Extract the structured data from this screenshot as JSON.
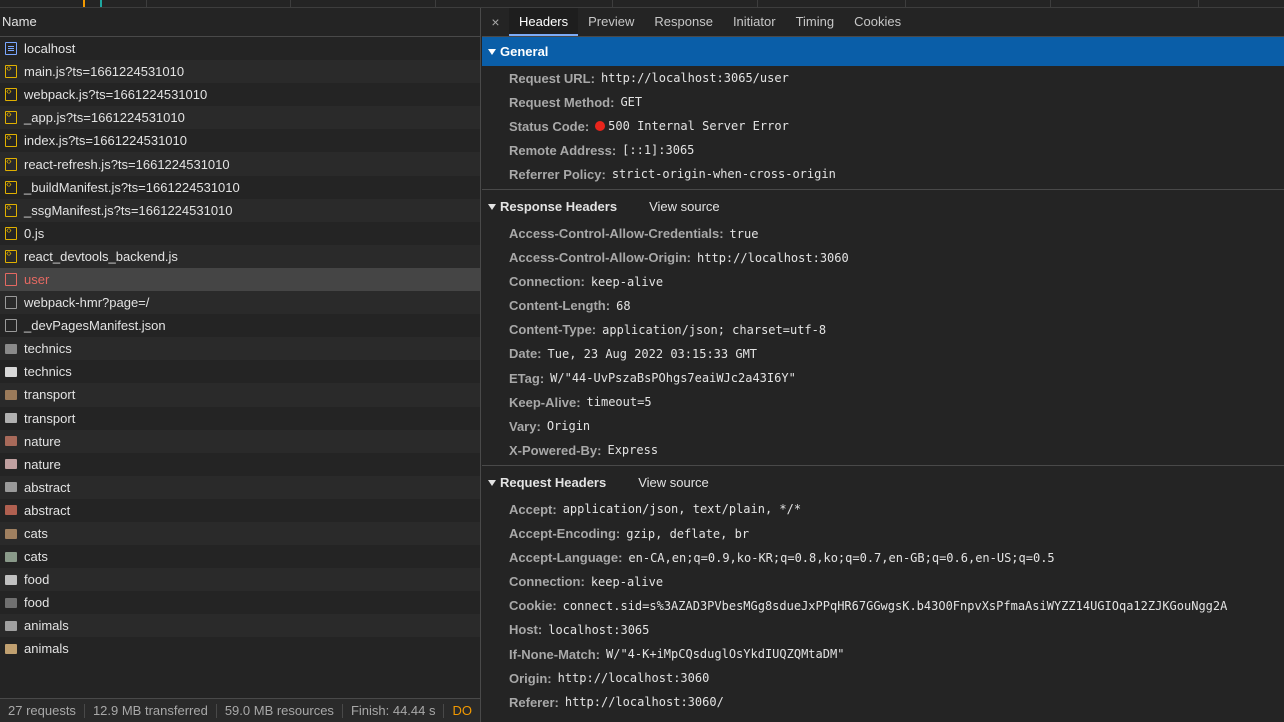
{
  "network": {
    "column_name": "Name",
    "requests": [
      {
        "name": "localhost",
        "icon": "document-icon",
        "type": "doc"
      },
      {
        "name": "main.js?ts=1661224531010",
        "icon": "script-icon",
        "type": "js"
      },
      {
        "name": "webpack.js?ts=1661224531010",
        "icon": "script-icon",
        "type": "js"
      },
      {
        "name": "_app.js?ts=1661224531010",
        "icon": "script-icon",
        "type": "js"
      },
      {
        "name": "index.js?ts=1661224531010",
        "icon": "script-icon",
        "type": "js"
      },
      {
        "name": "react-refresh.js?ts=1661224531010",
        "icon": "script-icon",
        "type": "js"
      },
      {
        "name": "_buildManifest.js?ts=1661224531010",
        "icon": "script-icon",
        "type": "js"
      },
      {
        "name": "_ssgManifest.js?ts=1661224531010",
        "icon": "script-icon",
        "type": "js"
      },
      {
        "name": "0.js",
        "icon": "script-icon",
        "type": "js"
      },
      {
        "name": "react_devtools_backend.js",
        "icon": "script-icon",
        "type": "js"
      },
      {
        "name": "user",
        "icon": "error-request-icon",
        "type": "error"
      },
      {
        "name": "webpack-hmr?page=/",
        "icon": "file-icon",
        "type": "plain"
      },
      {
        "name": "_devPagesManifest.json",
        "icon": "file-icon",
        "type": "plain"
      },
      {
        "name": "technics",
        "icon": "image-thumbnail-icon",
        "type": "img",
        "color": "#8a8a8a"
      },
      {
        "name": "technics",
        "icon": "image-thumbnail-icon",
        "type": "img",
        "color": "#d8d8d8"
      },
      {
        "name": "transport",
        "icon": "image-thumbnail-icon",
        "type": "img",
        "color": "#9a7a5a"
      },
      {
        "name": "transport",
        "icon": "image-thumbnail-icon",
        "type": "img",
        "color": "#b0b0b0"
      },
      {
        "name": "nature",
        "icon": "image-thumbnail-icon",
        "type": "img",
        "color": "#a86a5a"
      },
      {
        "name": "nature",
        "icon": "image-thumbnail-icon",
        "type": "img",
        "color": "#c0a0a0"
      },
      {
        "name": "abstract",
        "icon": "image-thumbnail-icon",
        "type": "img",
        "color": "#9a9a9a"
      },
      {
        "name": "abstract",
        "icon": "image-thumbnail-icon",
        "type": "img",
        "color": "#b06050"
      },
      {
        "name": "cats",
        "icon": "image-thumbnail-icon",
        "type": "img",
        "color": "#a08060"
      },
      {
        "name": "cats",
        "icon": "image-thumbnail-icon",
        "type": "img",
        "color": "#8a9a8a"
      },
      {
        "name": "food",
        "icon": "image-thumbnail-icon",
        "type": "img",
        "color": "#c0c0c0"
      },
      {
        "name": "food",
        "icon": "image-thumbnail-icon",
        "type": "img",
        "color": "#707070"
      },
      {
        "name": "animals",
        "icon": "image-thumbnail-icon",
        "type": "img",
        "color": "#a0a0a0"
      },
      {
        "name": "animals",
        "icon": "image-thumbnail-icon",
        "type": "img",
        "color": "#c0a070"
      }
    ],
    "selected_request": "user",
    "status": {
      "requests": "27 requests",
      "transferred": "12.9 MB transferred",
      "resources": "59.0 MB resources",
      "finish": "Finish: 44.44 s",
      "dom": "DO"
    }
  },
  "detail": {
    "close_glyph": "×",
    "tabs": [
      "Headers",
      "Preview",
      "Response",
      "Initiator",
      "Timing",
      "Cookies"
    ],
    "active_tab": "Headers",
    "general": {
      "title": "General",
      "items": [
        {
          "key": "Request URL:",
          "value": "http://localhost:3065/user"
        },
        {
          "key": "Request Method:",
          "value": "GET"
        },
        {
          "key": "Status Code:",
          "value": "500 Internal Server Error",
          "status_color": "#e8251c"
        },
        {
          "key": "Remote Address:",
          "value": "[::1]:3065"
        },
        {
          "key": "Referrer Policy:",
          "value": "strict-origin-when-cross-origin"
        }
      ]
    },
    "response_headers": {
      "title": "Response Headers",
      "view_source": "View source",
      "items": [
        {
          "key": "Access-Control-Allow-Credentials:",
          "value": "true"
        },
        {
          "key": "Access-Control-Allow-Origin:",
          "value": "http://localhost:3060"
        },
        {
          "key": "Connection:",
          "value": "keep-alive"
        },
        {
          "key": "Content-Length:",
          "value": "68"
        },
        {
          "key": "Content-Type:",
          "value": "application/json; charset=utf-8"
        },
        {
          "key": "Date:",
          "value": "Tue, 23 Aug 2022 03:15:33 GMT"
        },
        {
          "key": "ETag:",
          "value": "W/\"44-UvPszaBsPOhgs7eaiWJc2a43I6Y\""
        },
        {
          "key": "Keep-Alive:",
          "value": "timeout=5"
        },
        {
          "key": "Vary:",
          "value": "Origin"
        },
        {
          "key": "X-Powered-By:",
          "value": "Express"
        }
      ]
    },
    "request_headers": {
      "title": "Request Headers",
      "view_source": "View source",
      "items": [
        {
          "key": "Accept:",
          "value": "application/json, text/plain, */*"
        },
        {
          "key": "Accept-Encoding:",
          "value": "gzip, deflate, br"
        },
        {
          "key": "Accept-Language:",
          "value": "en-CA,en;q=0.9,ko-KR;q=0.8,ko;q=0.7,en-GB;q=0.6,en-US;q=0.5"
        },
        {
          "key": "Connection:",
          "value": "keep-alive"
        },
        {
          "key": "Cookie:",
          "value": "connect.sid=s%3AZAD3PVbesMGg8sdueJxPPqHR67GGwgsK.b43O0FnpvXsPfmaAsiWYZZ14UGIOqa12ZJKGouNgg2A"
        },
        {
          "key": "Host:",
          "value": "localhost:3065"
        },
        {
          "key": "If-None-Match:",
          "value": "W/\"4-K+iMpCQsduglOsYkdIUQZQMtaDM\""
        },
        {
          "key": "Origin:",
          "value": "http://localhost:3060"
        },
        {
          "key": "Referer:",
          "value": "http://localhost:3060/"
        }
      ]
    }
  },
  "colors": {
    "accent_blue": "#0a5ea8",
    "error_red": "#e46962",
    "js_yellow": "#e0b000",
    "doc_blue": "#7aa7ff"
  }
}
